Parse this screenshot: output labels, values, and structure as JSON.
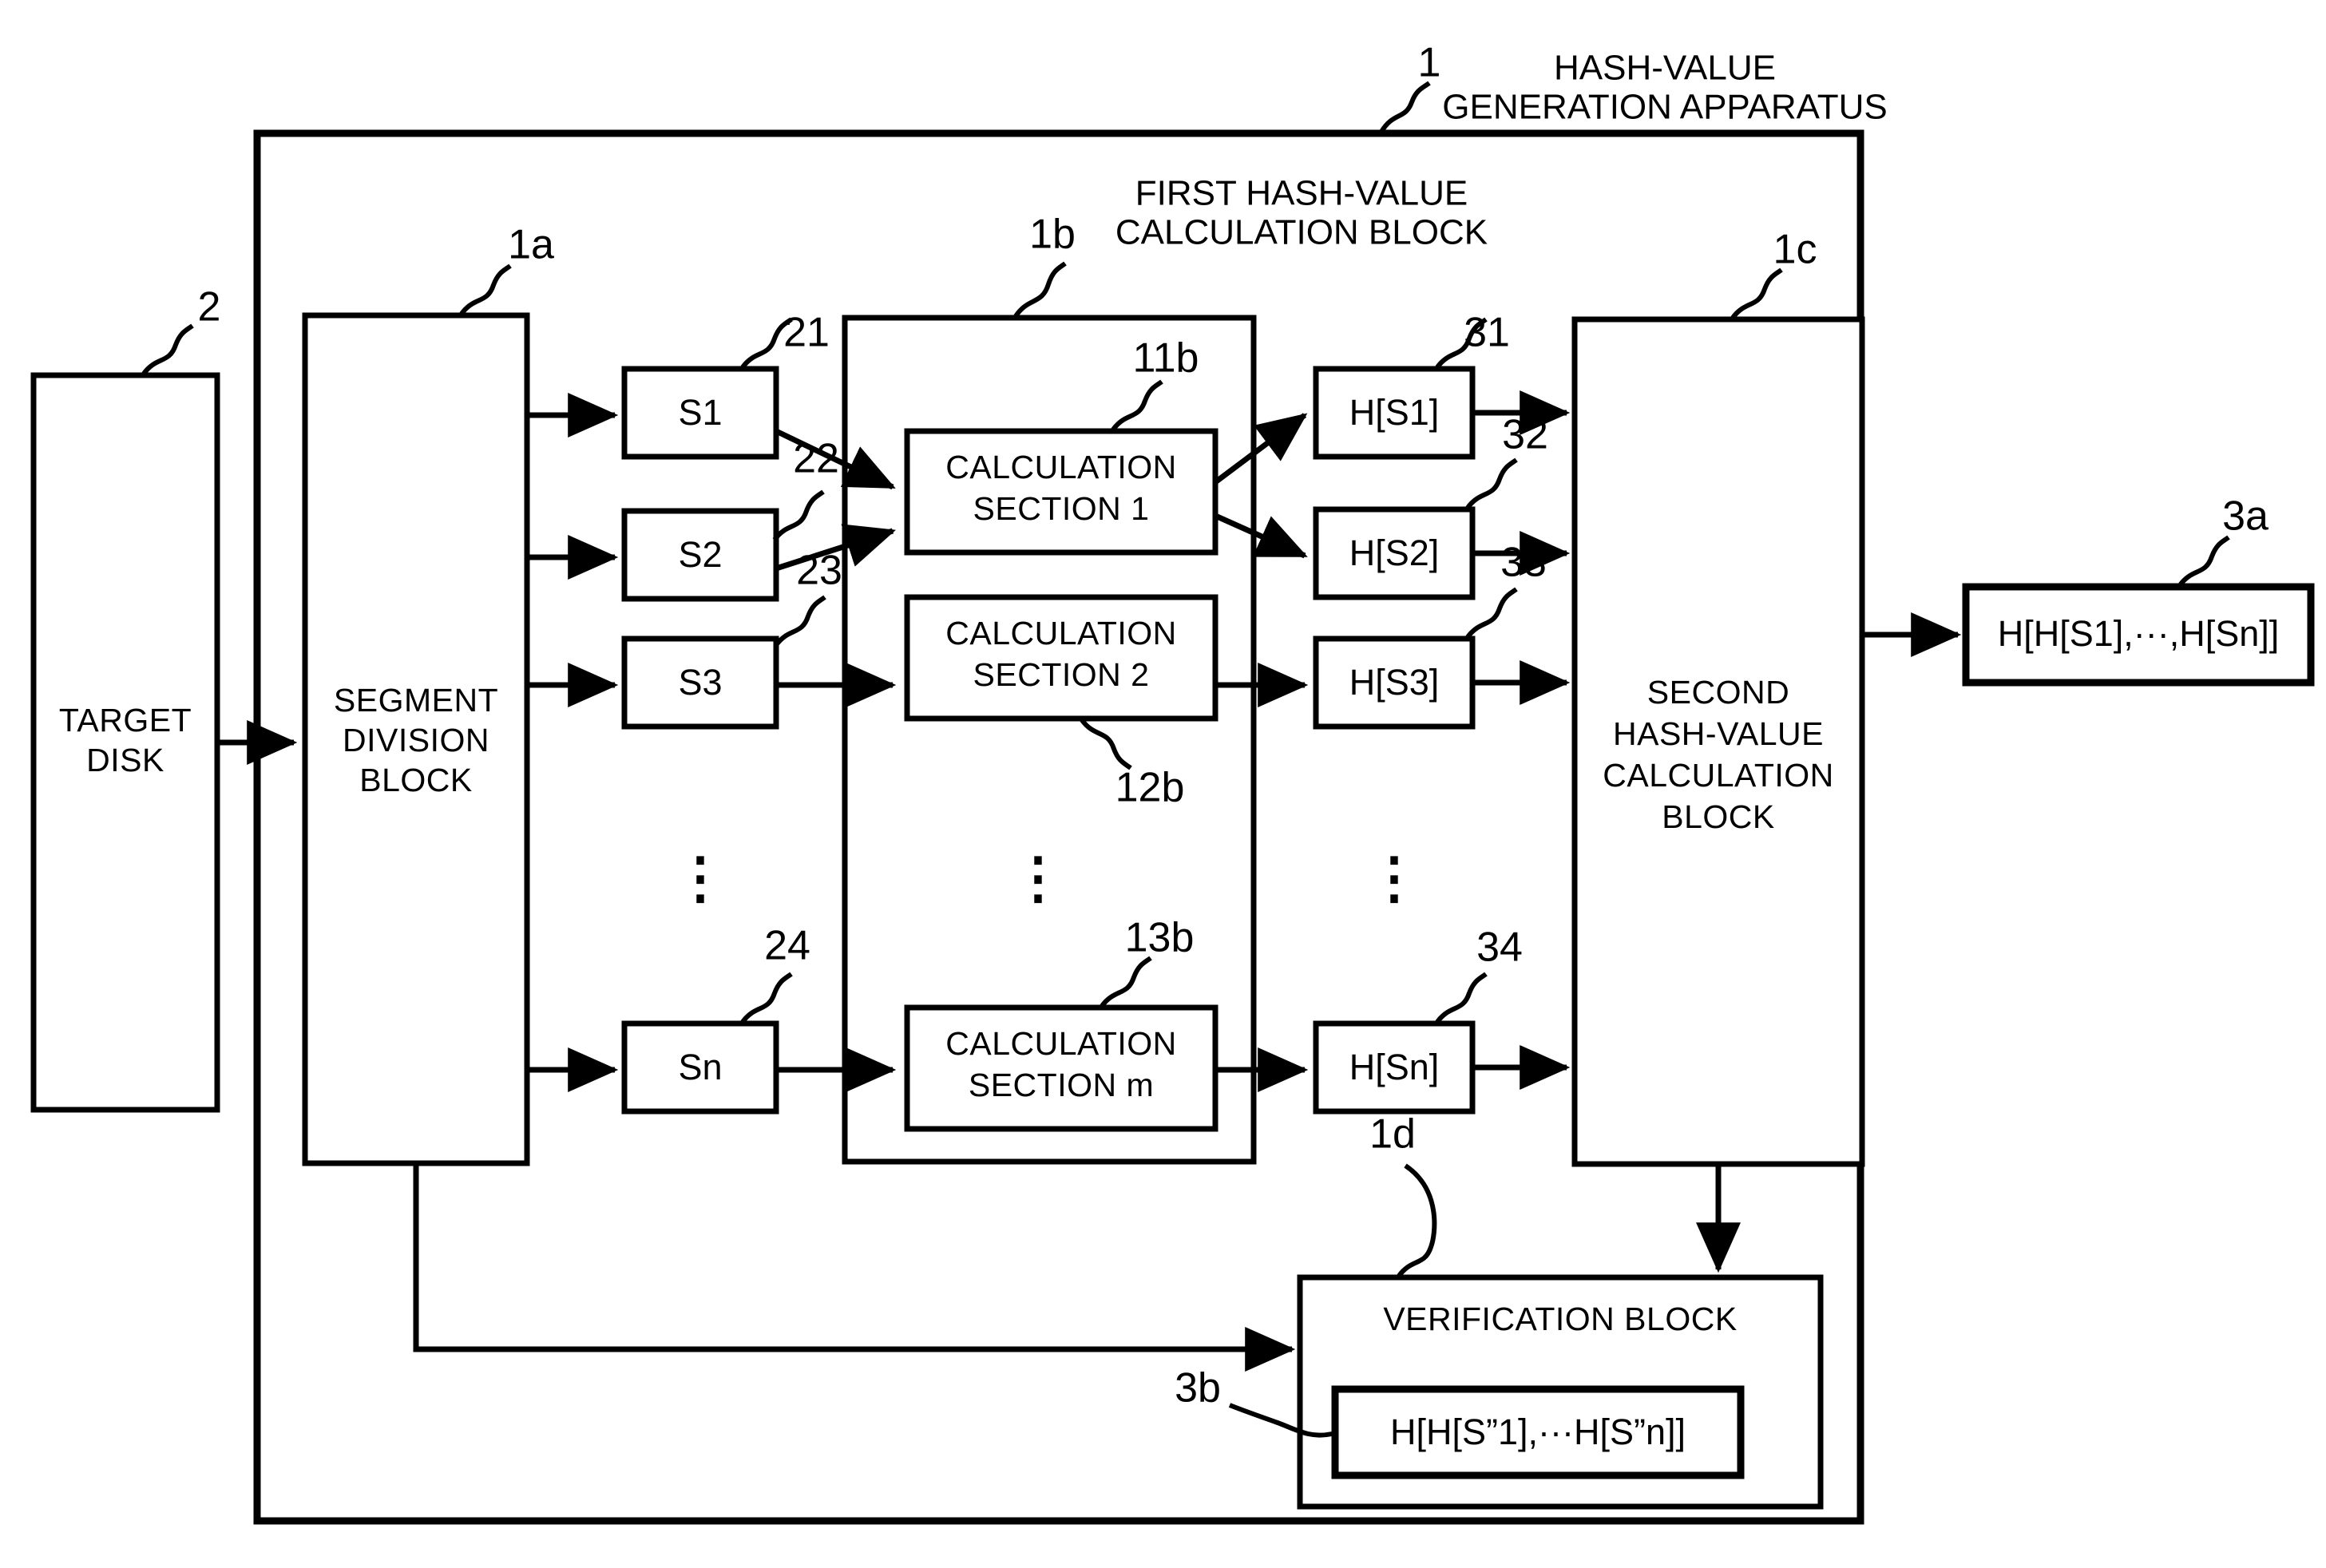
{
  "figure": {
    "apparatus_ref": "1",
    "apparatus_title_line1": "HASH-VALUE",
    "apparatus_title_line2": "GENERATION APPARATUS",
    "first_block_ref": "1b",
    "first_block_title_line1": "FIRST HASH-VALUE",
    "first_block_title_line2": "CALCULATION BLOCK"
  },
  "target_disk": {
    "ref": "2",
    "label_line1": "TARGET",
    "label_line2": "DISK"
  },
  "segment_division_block": {
    "ref": "1a",
    "label_line1": "SEGMENT",
    "label_line2": "DIVISION",
    "label_line3": "BLOCK"
  },
  "segments": [
    {
      "ref": "21",
      "label": "S1"
    },
    {
      "ref": "22",
      "label": "S2"
    },
    {
      "ref": "23",
      "label": "S3"
    },
    {
      "ref": "24",
      "label": "Sn"
    }
  ],
  "calculation_sections": [
    {
      "ref": "11b",
      "label_line1": "CALCULATION",
      "label_line2": "SECTION 1"
    },
    {
      "ref": "12b",
      "label_line1": "CALCULATION",
      "label_line2": "SECTION 2"
    },
    {
      "ref": "13b",
      "label_line1": "CALCULATION",
      "label_line2": "SECTION m"
    }
  ],
  "hash_values": [
    {
      "ref": "31",
      "label": "H[S1]"
    },
    {
      "ref": "32",
      "label": "H[S2]"
    },
    {
      "ref": "33",
      "label": "H[S3]"
    },
    {
      "ref": "34",
      "label": "H[Sn]"
    }
  ],
  "second_block": {
    "ref": "1c",
    "label_line1": "SECOND",
    "label_line2": "HASH-VALUE",
    "label_line3": "CALCULATION",
    "label_line4": "BLOCK"
  },
  "output": {
    "ref": "3a",
    "label": "H[H[S1],···,H[Sn]]"
  },
  "verification_block": {
    "ref": "1d",
    "label": "VERIFICATION BLOCK",
    "stored_hash_ref": "3b",
    "stored_hash_label": "H[H[S”1],···H[S”n]]"
  },
  "ellipsis_glyph": "⋮",
  "colors": {
    "stroke": "#000000",
    "fill": "#ffffff"
  }
}
